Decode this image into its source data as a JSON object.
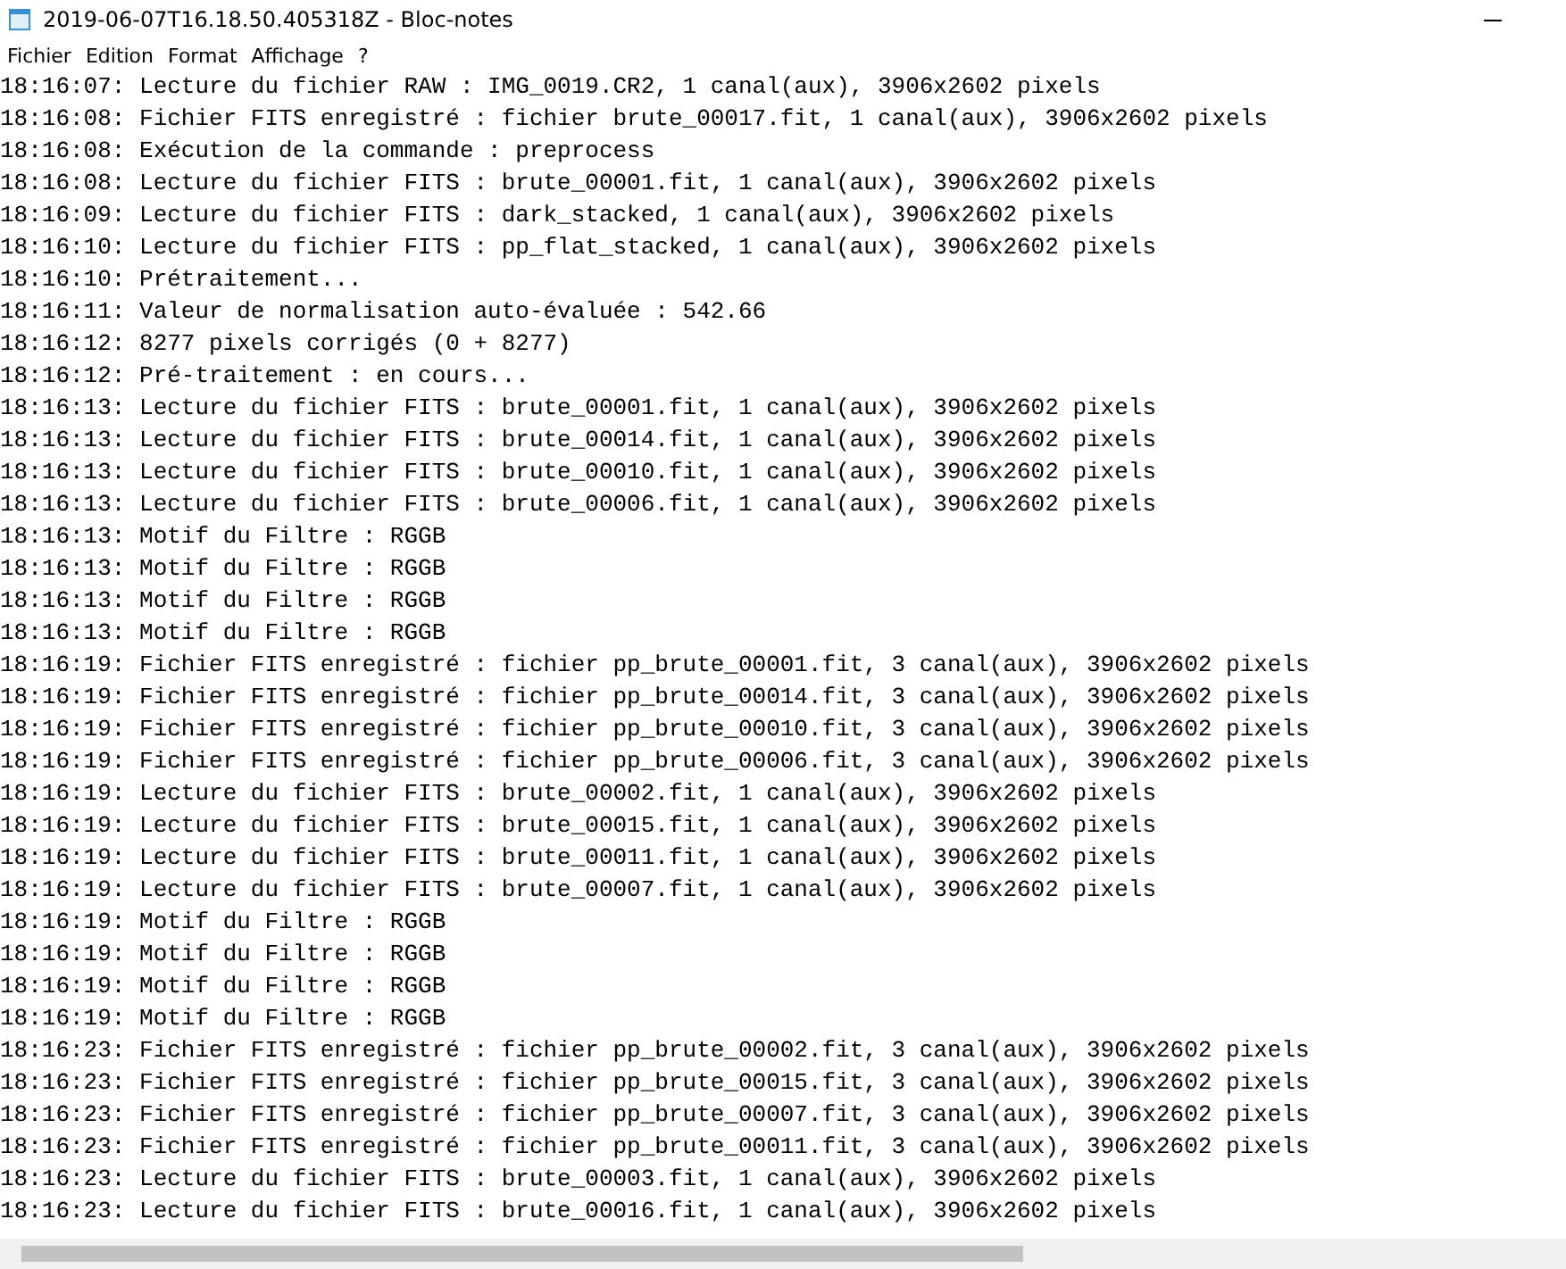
{
  "window": {
    "title": "2019-06-07T16.18.50.405318Z - Bloc-notes"
  },
  "menu": [
    "Fichier",
    "Edition",
    "Format",
    "Affichage",
    "?"
  ],
  "lines": [
    "18:16:07: Lecture du fichier RAW : IMG_0019.CR2, 1 canal(aux), 3906x2602 pixels",
    "18:16:08: Fichier FITS enregistré : fichier brute_00017.fit, 1 canal(aux), 3906x2602 pixels",
    "18:16:08: Exécution de la commande : preprocess",
    "18:16:08: Lecture du fichier FITS : brute_00001.fit, 1 canal(aux), 3906x2602 pixels",
    "18:16:09: Lecture du fichier FITS : dark_stacked, 1 canal(aux), 3906x2602 pixels",
    "18:16:10: Lecture du fichier FITS : pp_flat_stacked, 1 canal(aux), 3906x2602 pixels",
    "18:16:10: Prétraitement...",
    "18:16:11: Valeur de normalisation auto-évaluée : 542.66",
    "18:16:12: 8277 pixels corrigés (0 + 8277)",
    "18:16:12: Pré-traitement : en cours...",
    "18:16:13: Lecture du fichier FITS : brute_00001.fit, 1 canal(aux), 3906x2602 pixels",
    "18:16:13: Lecture du fichier FITS : brute_00014.fit, 1 canal(aux), 3906x2602 pixels",
    "18:16:13: Lecture du fichier FITS : brute_00010.fit, 1 canal(aux), 3906x2602 pixels",
    "18:16:13: Lecture du fichier FITS : brute_00006.fit, 1 canal(aux), 3906x2602 pixels",
    "18:16:13: Motif du Filtre : RGGB",
    "18:16:13: Motif du Filtre : RGGB",
    "18:16:13: Motif du Filtre : RGGB",
    "18:16:13: Motif du Filtre : RGGB",
    "18:16:19: Fichier FITS enregistré : fichier pp_brute_00001.fit, 3 canal(aux), 3906x2602 pixels",
    "18:16:19: Fichier FITS enregistré : fichier pp_brute_00014.fit, 3 canal(aux), 3906x2602 pixels",
    "18:16:19: Fichier FITS enregistré : fichier pp_brute_00010.fit, 3 canal(aux), 3906x2602 pixels",
    "18:16:19: Fichier FITS enregistré : fichier pp_brute_00006.fit, 3 canal(aux), 3906x2602 pixels",
    "18:16:19: Lecture du fichier FITS : brute_00002.fit, 1 canal(aux), 3906x2602 pixels",
    "18:16:19: Lecture du fichier FITS : brute_00015.fit, 1 canal(aux), 3906x2602 pixels",
    "18:16:19: Lecture du fichier FITS : brute_00011.fit, 1 canal(aux), 3906x2602 pixels",
    "18:16:19: Lecture du fichier FITS : brute_00007.fit, 1 canal(aux), 3906x2602 pixels",
    "18:16:19: Motif du Filtre : RGGB",
    "18:16:19: Motif du Filtre : RGGB",
    "18:16:19: Motif du Filtre : RGGB",
    "18:16:19: Motif du Filtre : RGGB",
    "18:16:23: Fichier FITS enregistré : fichier pp_brute_00002.fit, 3 canal(aux), 3906x2602 pixels",
    "18:16:23: Fichier FITS enregistré : fichier pp_brute_00015.fit, 3 canal(aux), 3906x2602 pixels",
    "18:16:23: Fichier FITS enregistré : fichier pp_brute_00007.fit, 3 canal(aux), 3906x2602 pixels",
    "18:16:23: Fichier FITS enregistré : fichier pp_brute_00011.fit, 3 canal(aux), 3906x2602 pixels",
    "18:16:23: Lecture du fichier FITS : brute_00003.fit, 1 canal(aux), 3906x2602 pixels",
    "18:16:23: Lecture du fichier FITS : brute_00016.fit, 1 canal(aux), 3906x2602 pixels"
  ]
}
